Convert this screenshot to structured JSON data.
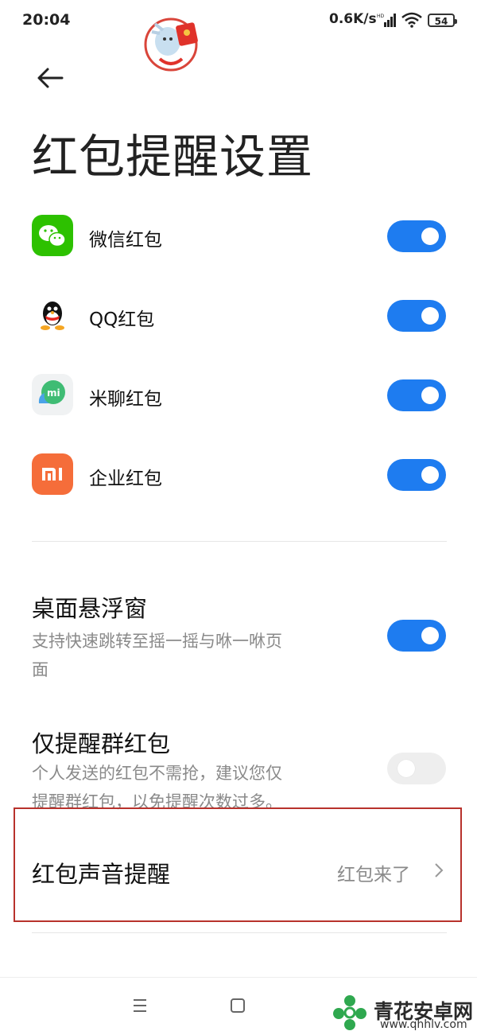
{
  "status_bar": {
    "time": "20:04",
    "speed": "0.6K/s",
    "battery": "54"
  },
  "page_title": "红包提醒设置",
  "apps": [
    {
      "label": "微信红包",
      "icon": "wechat-icon",
      "enabled": true
    },
    {
      "label": "QQ红包",
      "icon": "qq-icon",
      "enabled": true
    },
    {
      "label": "米聊红包",
      "icon": "miliao-icon",
      "enabled": true
    },
    {
      "label": "企业红包",
      "icon": "mi-enterprise-icon",
      "enabled": true
    }
  ],
  "floating_window": {
    "title": "桌面悬浮窗",
    "desc_line1": "支持快速跳转至摇一摇与咻一咻页",
    "desc_line2": "面",
    "enabled": true
  },
  "group_only": {
    "title": "仅提醒群红包",
    "desc_line1": "个人发送的红包不需抢，建议您仅",
    "desc_line2": "提醒群红包，以免提醒次数过多。",
    "enabled": false
  },
  "sound": {
    "label": "红包声音提醒",
    "value": "红包来了"
  },
  "colors": {
    "accent": "#1e7cf0",
    "highlight": "#b8322c",
    "wechat": "#2dc100",
    "mi": "#f56d3a"
  },
  "watermark": {
    "name": "青花安卓网",
    "url": "www.qhhlv.com"
  }
}
